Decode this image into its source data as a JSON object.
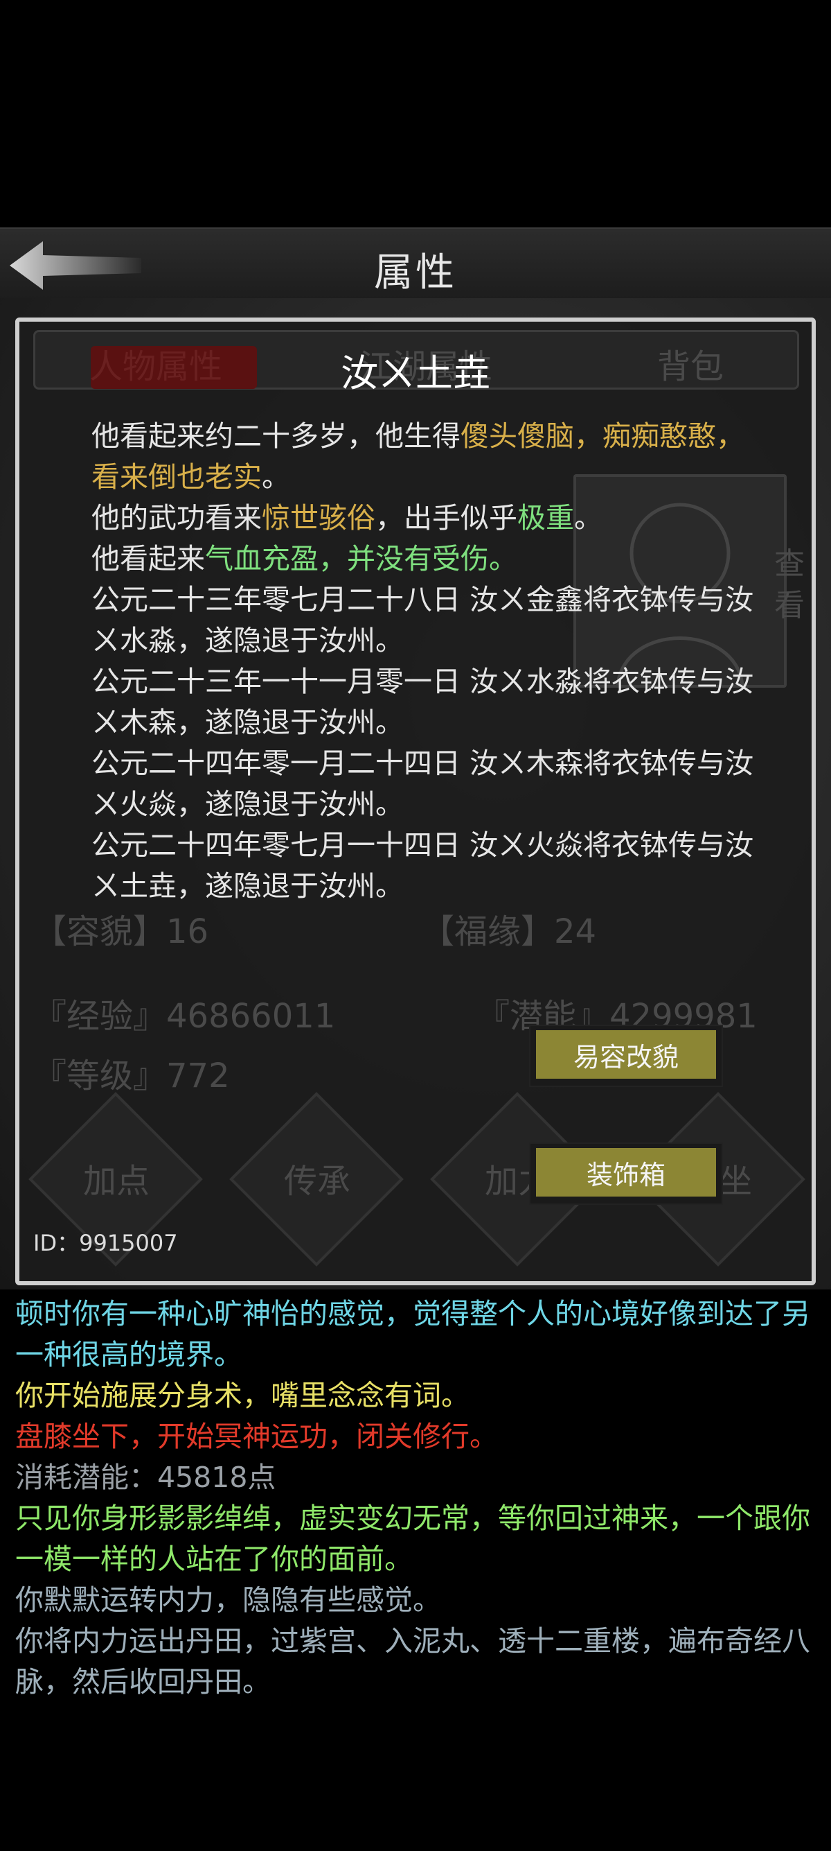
{
  "header": {
    "title": "属性"
  },
  "background_ui": {
    "tabs": [
      "人物属性",
      "江湖属性",
      "背包"
    ],
    "side_button": "查看",
    "bottom_buttons": [
      "加点",
      "传承",
      "加力",
      "打坐"
    ],
    "stats": [
      "『经验』46866011",
      "『潜能』4299981",
      "『等级』772",
      "【容貌】16",
      "【福缘】24"
    ]
  },
  "dialog": {
    "name": "汝ㄨ土垚",
    "lines": [
      [
        {
          "t": "他看起来约二十多岁，他生得",
          "c": ""
        },
        {
          "t": "傻头傻脑，痴痴憨憨，看来倒也老实",
          "c": "yel"
        },
        {
          "t": "。",
          "c": ""
        }
      ],
      [
        {
          "t": "他的武功看来",
          "c": ""
        },
        {
          "t": "惊世骇俗",
          "c": "yel"
        },
        {
          "t": "，出手似乎",
          "c": ""
        },
        {
          "t": "极重",
          "c": "grn"
        },
        {
          "t": "。",
          "c": ""
        }
      ],
      [
        {
          "t": "他看起来",
          "c": ""
        },
        {
          "t": "气血充盈，并没有受伤。",
          "c": "grn"
        }
      ],
      [
        {
          "t": "公元二十三年零七月二十八日 汝ㄨ金鑫将衣钵传与汝ㄨ水淼，遂隐退于汝州。",
          "c": ""
        }
      ],
      [
        {
          "t": "公元二十三年一十一月零一日 汝ㄨ水淼将衣钵传与汝ㄨ木森，遂隐退于汝州。",
          "c": ""
        }
      ],
      [
        {
          "t": "公元二十四年零一月二十四日 汝ㄨ木森将衣钵传与汝ㄨ火焱，遂隐退于汝州。",
          "c": ""
        }
      ],
      [
        {
          "t": "公元二十四年零七月一十四日 汝ㄨ火焱将衣钵传与汝ㄨ土垚，遂隐退于汝州。",
          "c": ""
        }
      ]
    ],
    "buttons": {
      "change_appearance": "易容改貌",
      "decoration_box": "装饰箱"
    },
    "id_label": "ID：9915007"
  },
  "log": [
    {
      "text": "顿时你有一种心旷神怡的感觉，觉得整个人的心境好像到达了另一种很高的境界。",
      "color": "#6fd6e6"
    },
    {
      "text": "你开始施展分身术，嘴里念念有词。",
      "color": "#e8e066"
    },
    {
      "text": "盘膝坐下，开始冥神运功，闭关修行。",
      "color": "#e23a2a"
    },
    {
      "text": "消耗潜能：45818点",
      "color": "#9aa0a6"
    },
    {
      "text": "只见你身形影影绰绰，虚实变幻无常，等你回过神来，一个跟你一模一样的人站在了你的面前。",
      "color": "#8fe86a"
    },
    {
      "text": "你默默运转内力，隐隐有些感觉。",
      "color": "#9fb0bb"
    },
    {
      "text": "你将内力运出丹田，过紫宫、入泥丸、透十二重楼，遍布奇经八脉，然后收回丹田。",
      "color": "#9fb0bb"
    }
  ]
}
